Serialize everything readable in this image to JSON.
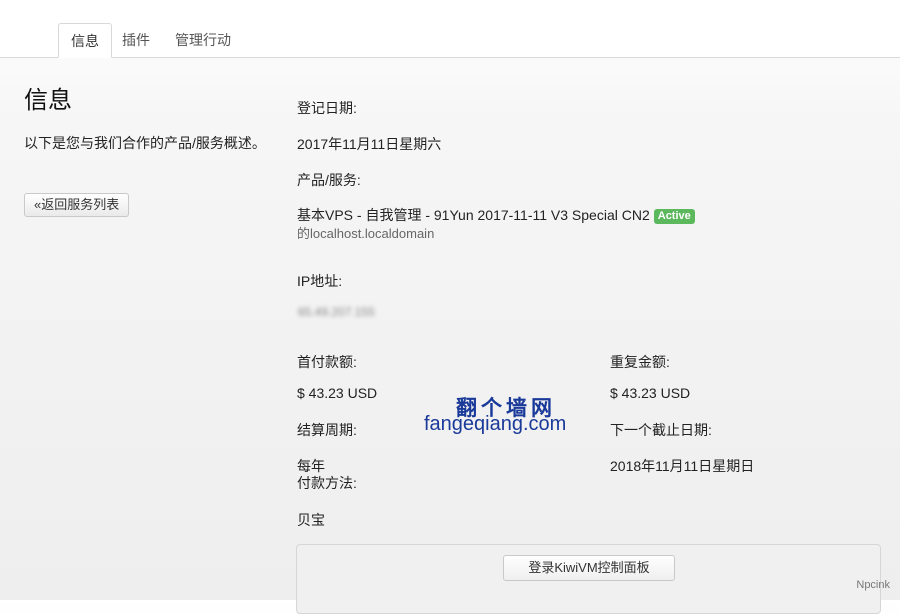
{
  "tabs": [
    {
      "label": "信息",
      "active": true
    },
    {
      "label": "插件",
      "active": false
    },
    {
      "label": "管理行动",
      "active": false
    }
  ],
  "left": {
    "title": "信息",
    "description": "以下是您与我们合作的产品/服务概述。",
    "back_button": "«返回服务列表"
  },
  "details": {
    "reg_date_label": "登记日期:",
    "reg_date_value": "2017年11月11日星期六",
    "product_label": "产品/服务:",
    "product_value": "基本VPS - 自我管理 - 91Yun 2017-11-11 V3 Special CN2",
    "status_badge": "Active",
    "product_host": "的localhost.localdomain",
    "ip_label": "IP地址:",
    "ip_value": "65.49.207.155",
    "first_payment_label": "首付款额:",
    "first_payment_value": "$ 43.23 USD",
    "recurring_label": "重复金额:",
    "recurring_value": "$ 43.23 USD",
    "billing_cycle_label": "结算周期:",
    "billing_cycle_value": "每年",
    "next_due_label": "下一个截止日期:",
    "next_due_value": "2018年11月11日星期日",
    "payment_method_label": "付款方法:",
    "payment_method_value": "贝宝"
  },
  "panel": {
    "kiwi_button": "登录KiwiVM控制面板"
  },
  "watermark": {
    "cn": "翻个墙网",
    "en": "fangeqiang.com"
  },
  "corner_mark": "Npcink",
  "colors": {
    "badge_active": "#5cb85c",
    "watermark": "#1a3a9a"
  }
}
